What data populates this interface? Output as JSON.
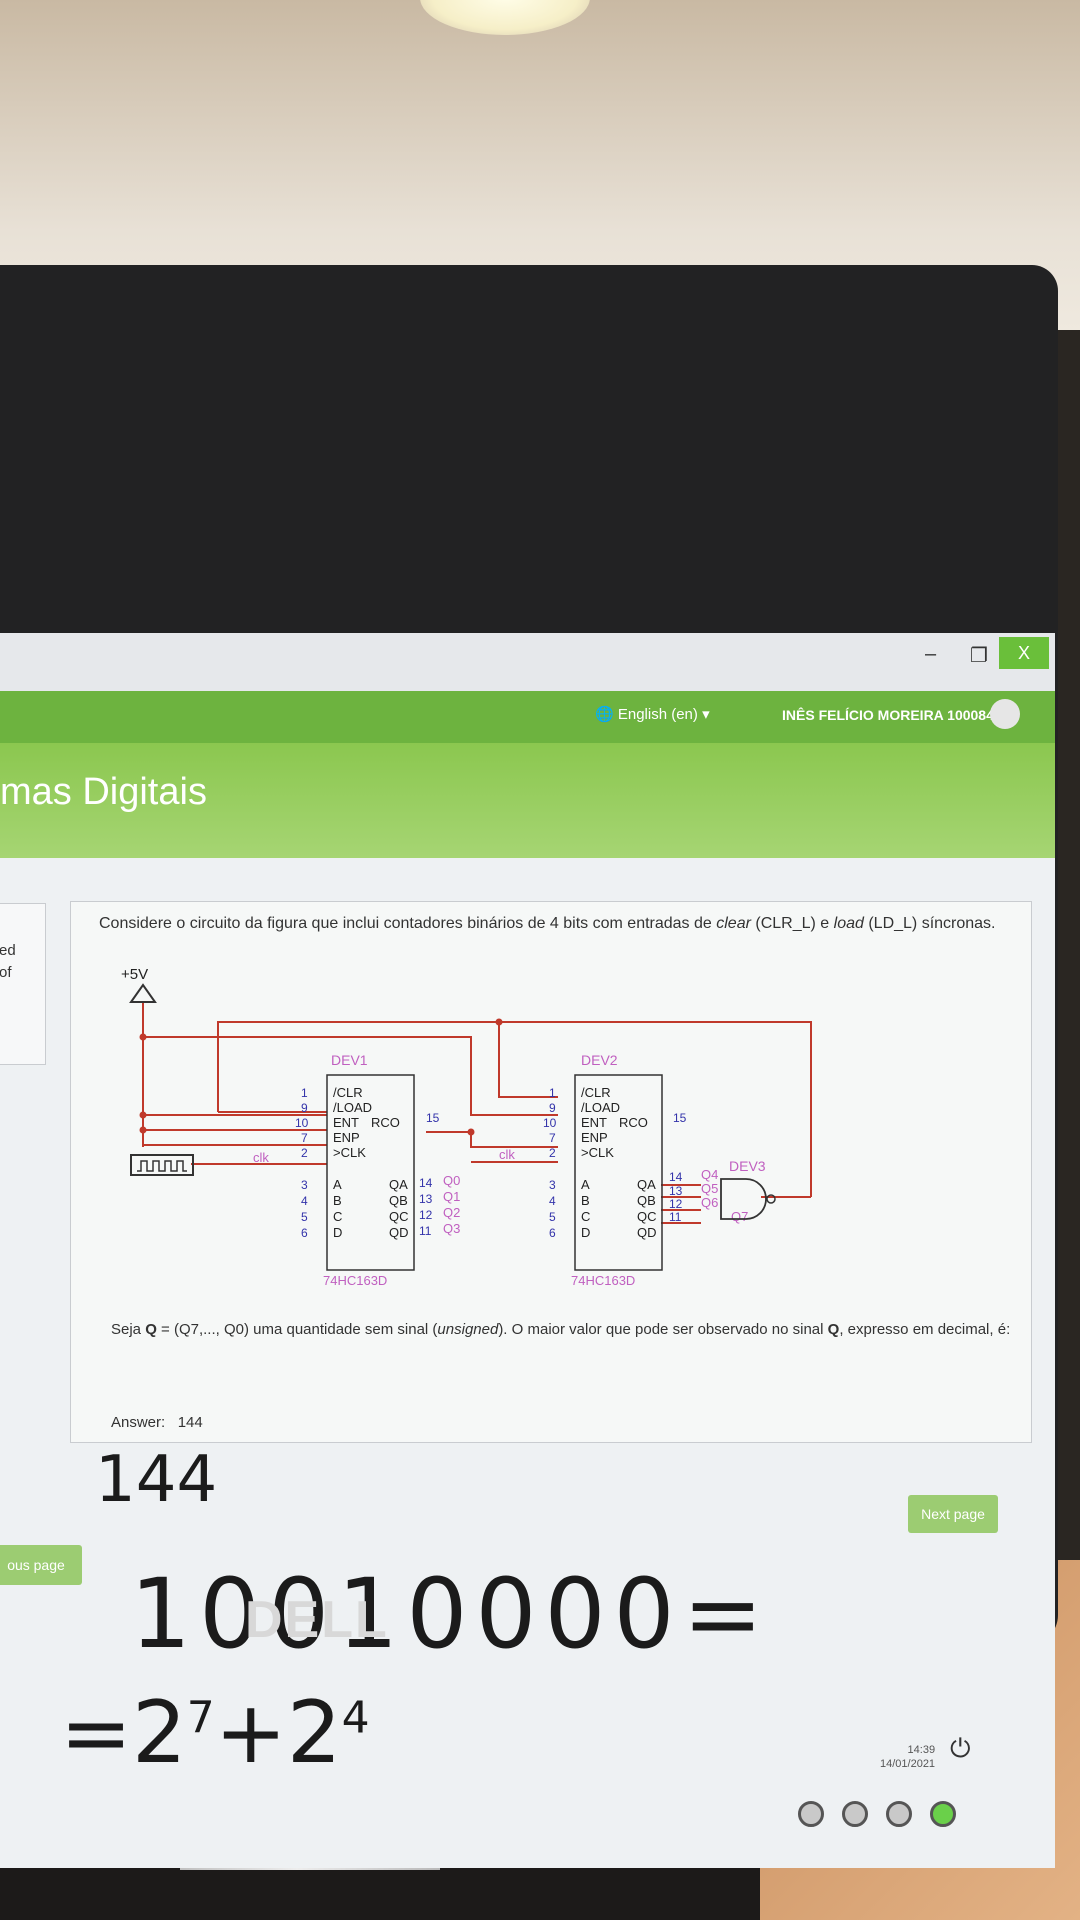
{
  "window": {
    "minimize": "‒",
    "restore": "❐",
    "close": "X"
  },
  "nav": {
    "language": "English (en) ▾",
    "user": "INÊS FELÍCIO MOREIRA 100084",
    "menu_icon": "hamburger-icon"
  },
  "course": {
    "title": "mas Digitais"
  },
  "left_block": {
    "line1": "ed",
    "line2": "of"
  },
  "question": {
    "intro_part1": "Considere o circuito da figura que inclui contadores binários de 4 bits com entradas de ",
    "intro_clear": "clear",
    "intro_part2": " (CLR_L) e ",
    "intro_load": "load",
    "intro_part3": " (LD_L) síncronas.",
    "sub_part1": "Seja ",
    "sub_q": "Q",
    "sub_part2": " = (Q7,..., Q0) uma quantidade sem sinal (",
    "sub_unsigned": "unsigned",
    "sub_part3": "). O maior valor que pode ser observado no sinal ",
    "sub_q2": "Q",
    "sub_part4": ", expresso em decimal, é:",
    "answer_label": "Answer:",
    "answer_value": "144"
  },
  "circuit": {
    "vcc": "+5V",
    "clk": "clk",
    "dev1": "DEV1",
    "dev2": "DEV2",
    "dev3": "DEV3",
    "part": "74HC163D",
    "pin_labels": [
      "/CLR",
      "/LOAD",
      "ENT",
      "ENP",
      ">CLK",
      "A",
      "B",
      "C",
      "D"
    ],
    "pin_numbers": [
      "1",
      "9",
      "10",
      "7",
      "2",
      "3",
      "4",
      "5",
      "6"
    ],
    "rco": "RCO",
    "rco_pin": "15",
    "q_labels": [
      "QA",
      "QB",
      "QC",
      "QD"
    ],
    "q_pins": [
      "14",
      "13",
      "12",
      "11"
    ],
    "dev1_outputs": [
      "Q0",
      "Q1",
      "Q2",
      "Q3"
    ],
    "dev2_outputs": [
      "Q4",
      "Q5",
      "Q6",
      "Q7"
    ]
  },
  "buttons": {
    "next": "Next page",
    "previous": "ous page"
  },
  "taskbar": {
    "time": "14:39",
    "date": "14/01/2021"
  },
  "handwriting": {
    "line1": "144",
    "line2": "10010000=",
    "line3_base1": "=2",
    "line3_exp1": "7",
    "line3_mid": "+2",
    "line3_exp2": "4"
  },
  "monitor": {
    "brand": "DELL"
  }
}
